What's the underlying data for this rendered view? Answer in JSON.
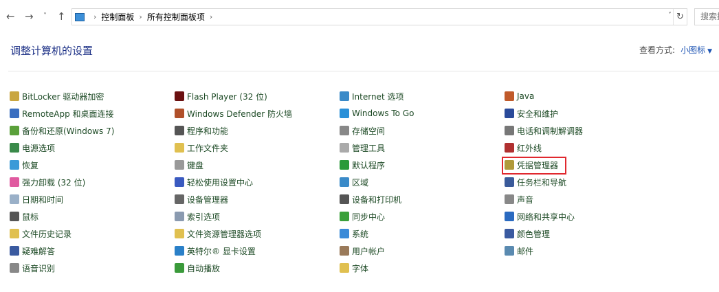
{
  "nav": {
    "back": "←",
    "forward": "→",
    "recent": "˅",
    "up": "↑"
  },
  "address": {
    "crumbs": [
      "控制面板",
      "所有控制面板项"
    ],
    "dropdown": "˅",
    "refresh": "↻"
  },
  "search": {
    "placeholder": "搜索控制面板"
  },
  "header": {
    "title": "调整计算机的设置",
    "view_label": "查看方式:",
    "view_value": "小图标"
  },
  "colors": {
    "link": "#1d4a25",
    "title": "#1e3287",
    "highlight": "#e0282e"
  },
  "columns": [
    [
      {
        "label": "BitLocker 驱动器加密",
        "icon": "key-icon",
        "c": "#c9a640"
      },
      {
        "label": "RemoteApp 和桌面连接",
        "icon": "remote-desktop-icon",
        "c": "#3a6ec0"
      },
      {
        "label": "备份和还原(Windows 7)",
        "icon": "backup-icon",
        "c": "#5aa03a"
      },
      {
        "label": "电源选项",
        "icon": "power-icon",
        "c": "#3a8a4a"
      },
      {
        "label": "恢复",
        "icon": "recovery-icon",
        "c": "#3a9ad8"
      },
      {
        "label": "强力卸载 (32 位)",
        "icon": "uninstall-icon",
        "c": "#e05aa0"
      },
      {
        "label": "日期和时间",
        "icon": "clock-icon",
        "c": "#9ab0c8"
      },
      {
        "label": "鼠标",
        "icon": "mouse-icon",
        "c": "#555"
      },
      {
        "label": "文件历史记录",
        "icon": "file-history-icon",
        "c": "#e0c050"
      },
      {
        "label": "疑难解答",
        "icon": "troubleshoot-icon",
        "c": "#3a5aa0"
      },
      {
        "label": "语音识别",
        "icon": "microphone-icon",
        "c": "#888"
      }
    ],
    [
      {
        "label": "Flash Player (32 位)",
        "icon": "flash-icon",
        "c": "#6a1010"
      },
      {
        "label": "Windows Defender 防火墙",
        "icon": "firewall-icon",
        "c": "#b0502a"
      },
      {
        "label": "程序和功能",
        "icon": "programs-icon",
        "c": "#555"
      },
      {
        "label": "工作文件夹",
        "icon": "work-folder-icon",
        "c": "#e0c050"
      },
      {
        "label": "键盘",
        "icon": "keyboard-icon",
        "c": "#999"
      },
      {
        "label": "轻松使用设置中心",
        "icon": "ease-of-access-icon",
        "c": "#3a5ac0"
      },
      {
        "label": "设备管理器",
        "icon": "device-manager-icon",
        "c": "#666"
      },
      {
        "label": "索引选项",
        "icon": "index-icon",
        "c": "#8a9ab0"
      },
      {
        "label": "文件资源管理器选项",
        "icon": "folder-options-icon",
        "c": "#e0c050"
      },
      {
        "label": "英特尔® 显卡设置",
        "icon": "intel-graphics-icon",
        "c": "#2a80c8"
      },
      {
        "label": "自动播放",
        "icon": "autoplay-icon",
        "c": "#3a9a3a"
      }
    ],
    [
      {
        "label": "Internet 选项",
        "icon": "globe-icon",
        "c": "#3a8ac8"
      },
      {
        "label": "Windows To Go",
        "icon": "windows-to-go-icon",
        "c": "#2a90d8"
      },
      {
        "label": "存储空间",
        "icon": "storage-icon",
        "c": "#888"
      },
      {
        "label": "管理工具",
        "icon": "admin-tools-icon",
        "c": "#aaa"
      },
      {
        "label": "默认程序",
        "icon": "default-programs-icon",
        "c": "#2a9a3a"
      },
      {
        "label": "区域",
        "icon": "region-icon",
        "c": "#3a8ac8"
      },
      {
        "label": "设备和打印机",
        "icon": "printer-icon",
        "c": "#555"
      },
      {
        "label": "同步中心",
        "icon": "sync-icon",
        "c": "#3aa03a"
      },
      {
        "label": "系统",
        "icon": "system-icon",
        "c": "#3a8ad8"
      },
      {
        "label": "用户帐户",
        "icon": "users-icon",
        "c": "#9a7a5a"
      },
      {
        "label": "字体",
        "icon": "font-icon",
        "c": "#e0c050"
      }
    ],
    [
      {
        "label": "Java",
        "icon": "java-icon",
        "c": "#c05a2a"
      },
      {
        "label": "安全和维护",
        "icon": "flag-icon",
        "c": "#2a4a9a"
      },
      {
        "label": "电话和调制解调器",
        "icon": "phone-icon",
        "c": "#777"
      },
      {
        "label": "红外线",
        "icon": "infrared-icon",
        "c": "#b03030"
      },
      {
        "label": "凭据管理器",
        "icon": "credential-icon",
        "c": "#b09a3a"
      },
      {
        "label": "任务栏和导航",
        "icon": "taskbar-icon",
        "c": "#3a5a9a"
      },
      {
        "label": "声音",
        "icon": "speaker-icon",
        "c": "#888"
      },
      {
        "label": "网络和共享中心",
        "icon": "network-icon",
        "c": "#2a6ac0"
      },
      {
        "label": "颜色管理",
        "icon": "color-icon",
        "c": "#3a5aa0"
      },
      {
        "label": "邮件",
        "icon": "mail-icon",
        "c": "#5a8ab0"
      }
    ]
  ]
}
